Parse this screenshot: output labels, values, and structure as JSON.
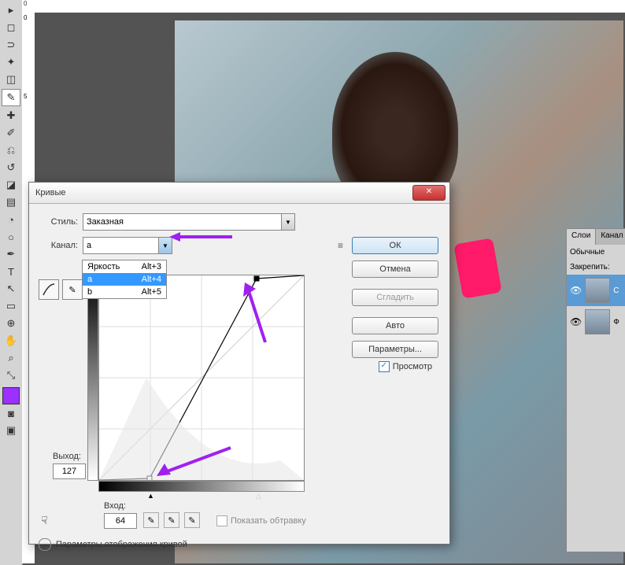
{
  "dialog": {
    "title": "Кривые",
    "style_label": "Стиль:",
    "style_value": "Заказная",
    "channel_label": "Канал:",
    "channel_value": "a",
    "dropdown": [
      {
        "label": "Яркость",
        "shortcut": "Alt+3"
      },
      {
        "label": "a",
        "shortcut": "Alt+4"
      },
      {
        "label": "b",
        "shortcut": "Alt+5"
      }
    ],
    "output_label": "Выход:",
    "output_value": "127",
    "input_label": "Вход:",
    "input_value": "64",
    "show_clip": "Показать обтравку",
    "expand_label": "Параметры отображения кривой",
    "buttons": {
      "ok": "ОК",
      "cancel": "Отмена",
      "smooth": "Сгладить",
      "auto": "Авто",
      "params": "Параметры..."
    },
    "preview": "Просмотр"
  },
  "layers": {
    "tab1": "Слои",
    "tab2": "Канал",
    "blend": "Обычные",
    "lock": "Закрепить:",
    "layer_active": "С",
    "layer_bg": "Ф"
  },
  "ruler": {
    "zero": "0",
    "five": "5"
  },
  "colors": {
    "accent": "#a020f0",
    "fg": "#9b30ff"
  }
}
